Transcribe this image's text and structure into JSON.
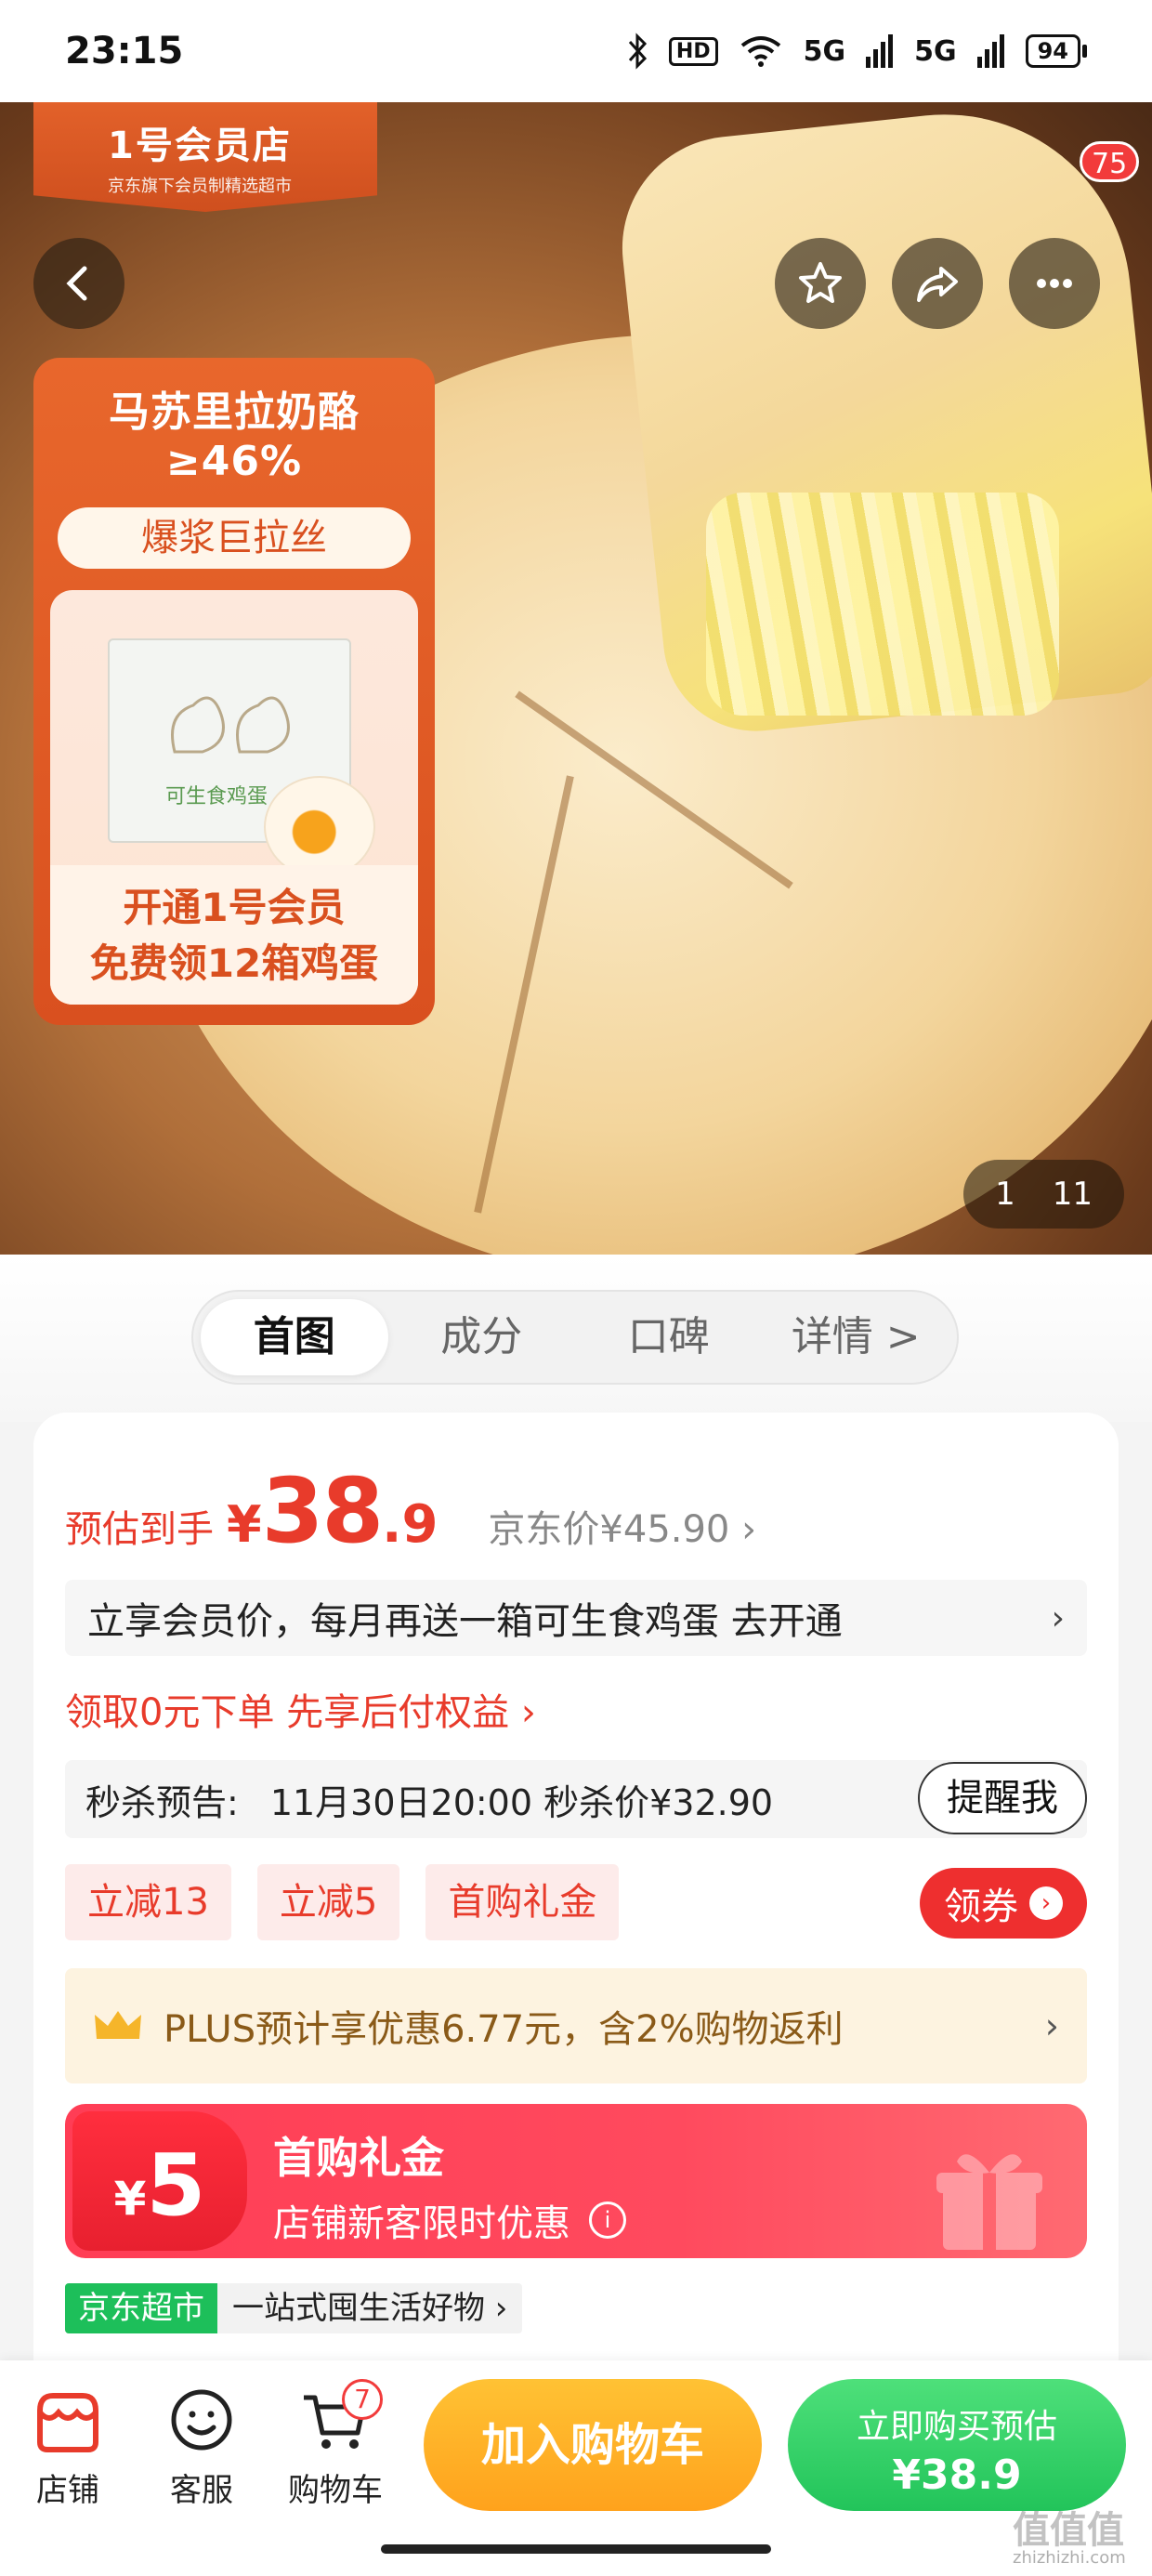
{
  "status_bar": {
    "time": "23:15",
    "hd_label": "HD",
    "signal_1": "5G",
    "signal_2": "5G",
    "battery": "94"
  },
  "hero": {
    "brand_name": "1号会员店",
    "brand_sub": "京东旗下会员制精选超市",
    "notification_count": "75",
    "promo_headline": "马苏里拉奶酪≥46%",
    "promo_pill": "爆浆巨拉丝",
    "egg_box_label": "可生食鸡蛋",
    "promo_bottom_line1": "开通1号会员",
    "promo_bottom_line2": "免费领12箱鸡蛋",
    "image_index": "1",
    "image_total": "11"
  },
  "tabs": [
    {
      "label": "首图",
      "active": true
    },
    {
      "label": "成分",
      "active": false
    },
    {
      "label": "口碑",
      "active": false
    },
    {
      "label": "详情 >",
      "active": false
    }
  ],
  "price": {
    "label": "预估到手",
    "currency": "¥",
    "integer": "38",
    "decimal": ".9",
    "jd_price": "京东价¥45.90 ›"
  },
  "member_offer": {
    "text": "立享会员价，每月再送一箱可生食鸡蛋 去开通",
    "chevron": "›"
  },
  "paylater": "领取0元下单 先享后付权益 ›",
  "seckill": {
    "label": "秒杀预告:",
    "info": "11月30日20:00 秒杀价¥32.90",
    "remind_button": "提醒我"
  },
  "coupons": [
    "立减13",
    "立减5",
    "首购礼金"
  ],
  "claim_button": "领券",
  "plus_offer": {
    "text": "PLUS预计享优惠6.77元，含2%购物返利",
    "chevron": "›"
  },
  "gift_banner": {
    "currency": "¥",
    "amount": "5",
    "title": "首购礼金",
    "subtitle": "店铺新客限时优惠",
    "info_glyph": "i"
  },
  "store": {
    "tag": "京东超市",
    "desc": "一站式囤生活好物 ›"
  },
  "bottom_nav": {
    "store_label": "店铺",
    "service_label": "客服",
    "cart_label": "购物车",
    "cart_count": "7",
    "add_to_cart": "加入购物车",
    "buy_now_line1": "立即购买预估",
    "buy_now_line2": "¥38.9"
  },
  "watermark": {
    "main": "值值值",
    "sub": "zhizhizhi.com"
  },
  "colors": {
    "accent_red": "#e83b2b",
    "brand_orange": "#d9501f",
    "add_cart_yellow": "#ffa21c",
    "buy_green": "#22c45a"
  }
}
